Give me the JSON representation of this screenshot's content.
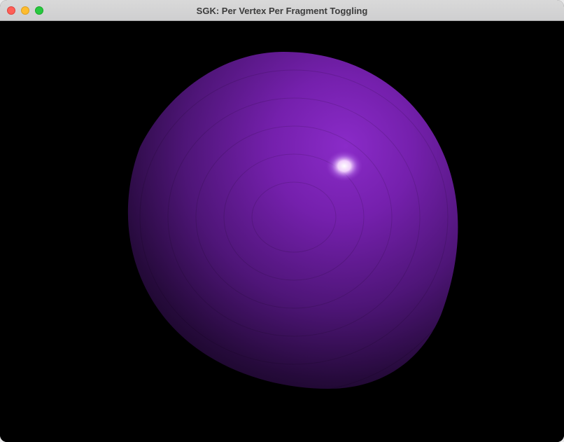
{
  "window": {
    "title": "SGK: Per Vertex Per Fragment Toggling"
  },
  "controls": {
    "close_icon": "close-icon",
    "minimize_icon": "minimize-icon",
    "zoom_icon": "zoom-icon"
  },
  "scene": {
    "background_color": "#000000",
    "sphere_color": "#7a1fb0",
    "sphere_dark_color": "#14061f",
    "highlight_color": "#ffffff"
  }
}
